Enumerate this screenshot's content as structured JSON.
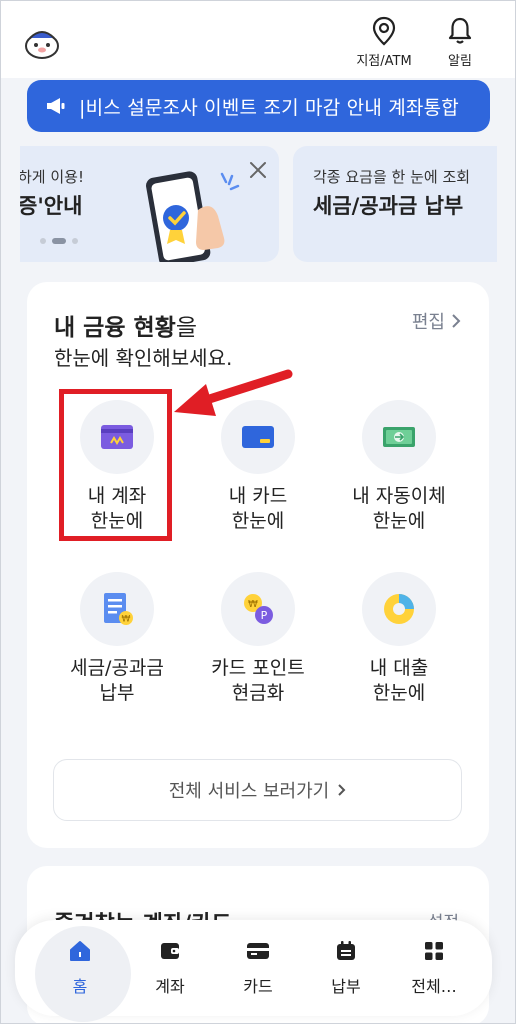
{
  "header": {
    "atm_label": "지점/ATM",
    "alarm_label": "알림"
  },
  "notice": {
    "text": "|비스 설문조사 이벤트 조기 마감 안내  계좌통합"
  },
  "promos": [
    {
      "sub": "하게 이용!",
      "title": "증'안내"
    },
    {
      "sub": "각종 요금을 한 눈에 조회",
      "title": "세금/공과금 납부"
    }
  ],
  "finance": {
    "title_bold": "내 금융 현황",
    "title_rest": "을",
    "subtitle": "한눈에 확인해보세요.",
    "edit_label": "편집",
    "services": [
      {
        "line1": "내 계좌",
        "line2": "한눈에",
        "icon": "account-card-icon"
      },
      {
        "line1": "내 카드",
        "line2": "한눈에",
        "icon": "credit-card-icon"
      },
      {
        "line1": "내 자동이체",
        "line2": "한눈에",
        "icon": "money-transfer-icon"
      },
      {
        "line1": "세금/공과금",
        "line2": "납부",
        "icon": "tax-bill-icon"
      },
      {
        "line1": "카드 포인트",
        "line2": "현금화",
        "icon": "card-points-icon"
      },
      {
        "line1": "내 대출",
        "line2": "한눈에",
        "icon": "loan-pie-icon"
      }
    ],
    "all_services_label": "전체 서비스 보러가기"
  },
  "card2": {
    "title": "즐겨찾는 계좌/카드",
    "setting": "설정"
  },
  "nav": {
    "items": [
      {
        "label": "홈",
        "icon": "home-icon"
      },
      {
        "label": "계좌",
        "icon": "wallet-icon"
      },
      {
        "label": "카드",
        "icon": "card-icon"
      },
      {
        "label": "납부",
        "icon": "bill-icon"
      },
      {
        "label": "전체…",
        "icon": "grid-icon"
      }
    ]
  },
  "colors": {
    "accent": "#2f66dc",
    "highlight_red": "#e01e25",
    "background": "#f2f4f8"
  }
}
